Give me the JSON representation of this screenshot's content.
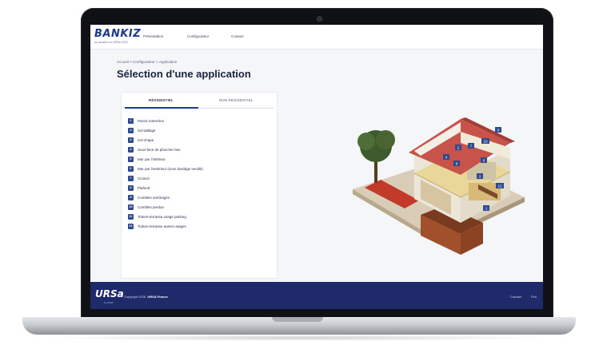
{
  "brand": {
    "logo": "BANKIZ",
    "logo_sub": "by Isolation ac URSA 2023"
  },
  "nav": [
    "Présentation",
    "Configurateur",
    "Contact"
  ],
  "breadcrumb": "Accueil  >  Configurateur  >  Application",
  "title": "Sélection d'une application",
  "tabs": [
    "RÉSIDENTIEL",
    "NON RÉSIDENTIEL"
  ],
  "applications": [
    {
      "num": "1",
      "label": "Parois enterrées"
    },
    {
      "num": "2",
      "label": "Sol-dallage"
    },
    {
      "num": "3",
      "label": "Sol-chape"
    },
    {
      "num": "4",
      "label": "Sous-face de plancher bas"
    },
    {
      "num": "5",
      "label": "Mur par l'intérieur"
    },
    {
      "num": "6",
      "label": "Mur par l'extérieur (sous bardage ventilé)"
    },
    {
      "num": "7",
      "label": "Cloison"
    },
    {
      "num": "8",
      "label": "Plafond"
    },
    {
      "num": "9",
      "label": "Combles aménagés"
    },
    {
      "num": "10",
      "label": "Combles perdus"
    },
    {
      "num": "11",
      "label": "Toiture-terrasse usage parking"
    },
    {
      "num": "12",
      "label": "Toiture-terrasse autres usages"
    }
  ],
  "footer": {
    "brand": "URSa",
    "brand_sub": "by ETEX",
    "copyright": "Copyright 2026",
    "company": "URSA France",
    "links": [
      "Contact",
      "Poli"
    ]
  },
  "colors": {
    "primary": "#1d3a8f",
    "footer": "#1f2a6b",
    "badge": "#2f4a8f"
  },
  "house_markers": [
    "9",
    "7",
    "10",
    "2",
    "6",
    "12",
    "8",
    "3",
    "4",
    "1"
  ]
}
